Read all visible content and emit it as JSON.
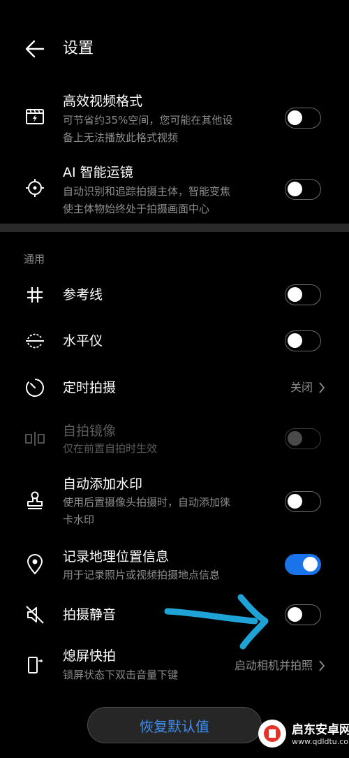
{
  "header": {
    "title": "设置",
    "back_icon": "back-arrow-icon"
  },
  "settings_top": [
    {
      "icon": "video-format-icon",
      "title": "高效视频格式",
      "subtitle_lines": [
        "可节省约35%空间，您可能在其他设",
        "备上无法播放此格式视频"
      ],
      "toggle": "off"
    },
    {
      "icon": "crosshair-target-icon",
      "title": "AI 智能运镜",
      "subtitle_lines": [
        "自动识别和追踪拍摄主体，智能变焦",
        "使主体物始终处于拍摄画面中心"
      ],
      "toggle": "off"
    }
  ],
  "section_general": {
    "label": "通用",
    "items": [
      {
        "icon": "grid-hash-icon",
        "title": "参考线",
        "toggle": "off"
      },
      {
        "icon": "level-icon",
        "title": "水平仪",
        "toggle": "off"
      },
      {
        "icon": "timer-icon",
        "title": "定时拍摄",
        "value": "关闭"
      },
      {
        "icon": "mirror-icon",
        "title": "自拍镜像",
        "subtitle": "仅在前置自拍时生效",
        "toggle": "off",
        "disabled": true
      },
      {
        "icon": "stamp-icon",
        "title": "自动添加水印",
        "subtitle_lines": [
          "使用后置摄像头拍摄时，自动添加徕",
          "卡水印"
        ],
        "toggle": "off"
      },
      {
        "icon": "location-pin-icon",
        "title": "记录地理位置信息",
        "subtitle": "用于记录照片或视频拍摄地点信息",
        "toggle": "on"
      },
      {
        "icon": "mute-speaker-icon",
        "title": "拍摄静音",
        "toggle": "off"
      },
      {
        "icon": "quick-snap-icon",
        "title": "熄屏快拍",
        "subtitle": "锁屏状态下双击音量下键",
        "value": "启动相机并拍照"
      }
    ]
  },
  "restore_button": "恢复默认值",
  "watermark": {
    "name": "启东安卓网",
    "url": "www.qdldtu.com"
  },
  "colors": {
    "background": "#000000",
    "accent": "#1a73e8",
    "button_text": "#3d8ef0",
    "annotation": "#1fa3d6"
  }
}
